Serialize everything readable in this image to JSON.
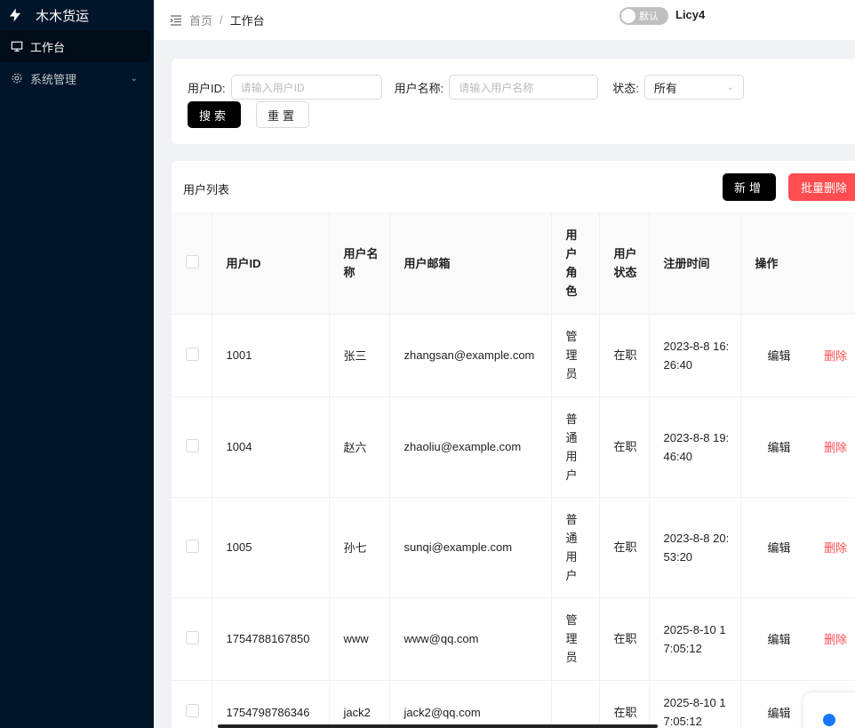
{
  "app": {
    "title": "木木货运"
  },
  "sidebar": {
    "items": [
      {
        "label": "工作台",
        "icon": "desktop-icon",
        "active": true
      },
      {
        "label": "系统管理",
        "icon": "gear-icon",
        "active": false
      }
    ]
  },
  "header": {
    "breadcrumb": [
      "首页",
      "/",
      "工作台"
    ],
    "theme_switch_label": "默认",
    "user": "Licy4"
  },
  "search": {
    "userid_label": "用户ID:",
    "userid_placeholder": "请输入用户ID",
    "username_label": "用户名称:",
    "username_placeholder": "请输入用户名称",
    "status_label": "状态:",
    "status_value": "所有",
    "search_button": "搜索",
    "reset_button": "重置"
  },
  "table": {
    "title": "用户列表",
    "add_button": "新增",
    "bulk_delete_button": "批量删除",
    "columns": [
      "用户ID",
      "用户名称",
      "用户邮箱",
      "用户角色",
      "用户状态",
      "注册时间",
      "操作"
    ],
    "edit_label": "编辑",
    "delete_label": "删除",
    "rows": [
      {
        "id": "1001",
        "name": "张三",
        "email": "zhangsan@example.com",
        "role": "管理员",
        "status": "在职",
        "time": "2023-8-8 16:26:40"
      },
      {
        "id": "1004",
        "name": "赵六",
        "email": "zhaoliu@example.com",
        "role": "普通用户",
        "status": "在职",
        "time": "2023-8-8 19:46:40"
      },
      {
        "id": "1005",
        "name": "孙七",
        "email": "sunqi@example.com",
        "role": "普通用户",
        "status": "在职",
        "time": "2023-8-8 20:53:20"
      },
      {
        "id": "1754788167850",
        "name": "www",
        "email": "www@qq.com",
        "role": "管理员",
        "status": "在职",
        "time": "2025-8-10 17:05:12"
      },
      {
        "id": "1754798786346",
        "name": "jack2",
        "email": "jack2@qq.com",
        "role": "",
        "status": "在职",
        "time": "2025-8-10 17:05:12"
      }
    ]
  },
  "colors": {
    "sidebar_bg": "#001529",
    "primary_button": "#000000",
    "danger": "#ff4d4f"
  }
}
